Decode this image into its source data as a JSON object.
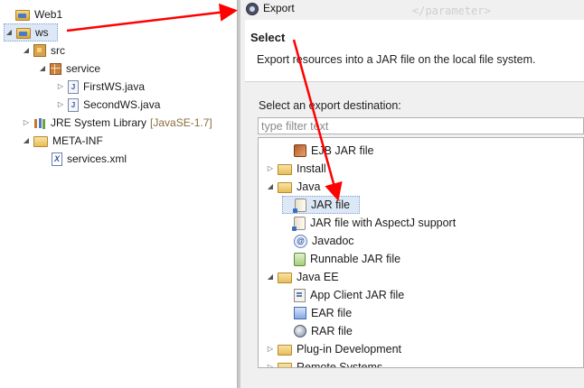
{
  "explorer": {
    "items": [
      {
        "label": "Web1",
        "icon": "project-folder-icon"
      },
      {
        "label": "ws",
        "icon": "project-folder-icon"
      },
      {
        "label": "src",
        "icon": "source-folder-icon"
      },
      {
        "label": "service",
        "icon": "package-icon"
      },
      {
        "label": "FirstWS.java",
        "icon": "java-file-icon"
      },
      {
        "label": "SecondWS.java",
        "icon": "java-file-icon"
      },
      {
        "label": "JRE System Library",
        "decoration": "[JavaSE-1.7]",
        "icon": "library-icon"
      },
      {
        "label": "META-INF",
        "icon": "folder-icon"
      },
      {
        "label": "services.xml",
        "icon": "xml-file-icon"
      }
    ]
  },
  "dialog": {
    "title": "Export",
    "background_text": "</parameter>",
    "header": {
      "title": "Select",
      "description": "Export resources into a JAR file on the local file system."
    },
    "destination_label": "Select an export destination:",
    "filter_placeholder": "type filter text",
    "tree": [
      {
        "label": "EJB JAR file",
        "icon": "ejb-jar-icon"
      },
      {
        "label": "Install",
        "icon": "folder-icon"
      },
      {
        "label": "Java",
        "icon": "folder-icon"
      },
      {
        "label": "JAR file",
        "icon": "jar-file-icon"
      },
      {
        "label": "JAR file with AspectJ support",
        "icon": "aspectj-jar-icon"
      },
      {
        "label": "Javadoc",
        "icon": "javadoc-icon"
      },
      {
        "label": "Runnable JAR file",
        "icon": "runnable-jar-icon"
      },
      {
        "label": "Java EE",
        "icon": "folder-icon"
      },
      {
        "label": "App Client JAR file",
        "icon": "app-client-icon"
      },
      {
        "label": "EAR file",
        "icon": "ear-file-icon"
      },
      {
        "label": "RAR file",
        "icon": "rar-file-icon"
      },
      {
        "label": "Plug-in Development",
        "icon": "folder-icon"
      },
      {
        "label": "Remote Systems",
        "icon": "folder-icon"
      }
    ]
  },
  "colors": {
    "annotation_arrow": "#ff0000",
    "selection": "#dde8f7",
    "dialog_bg": "#f0f0f0"
  }
}
